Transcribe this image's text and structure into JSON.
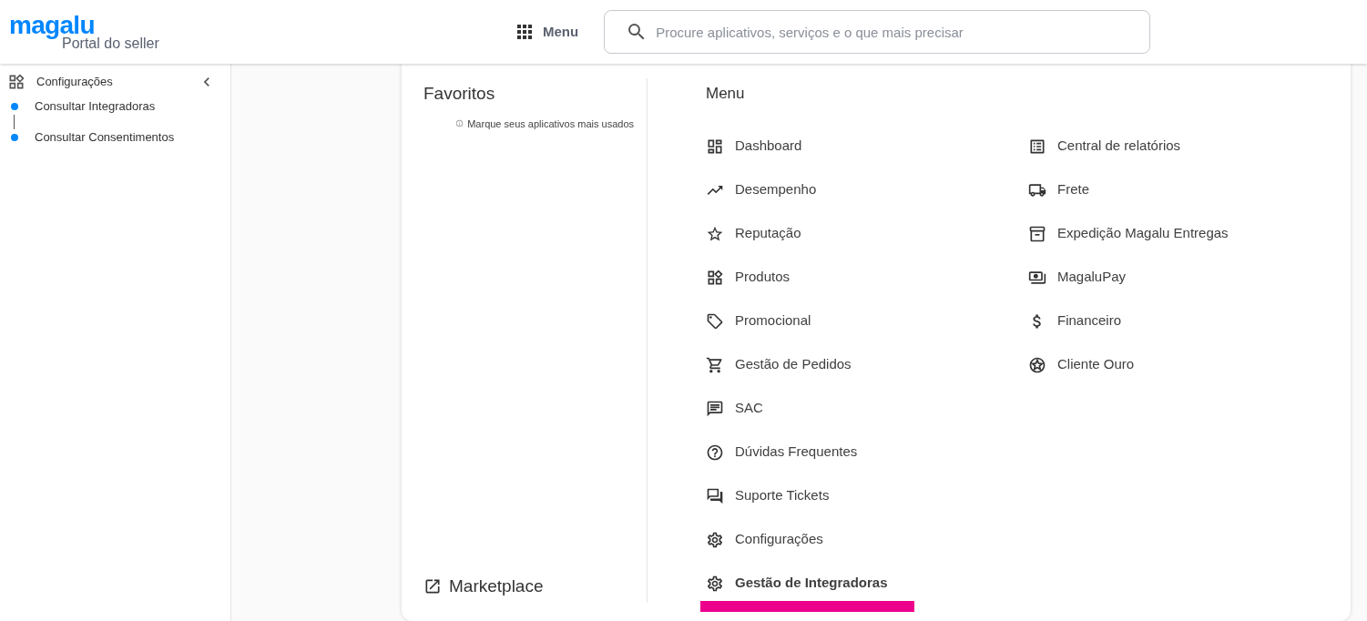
{
  "header": {
    "logo": "magalu",
    "subtitle": "Portal do seller",
    "menu_button": "Menu",
    "search": {
      "placeholder": "Procure aplicativos, serviços e o que mais precisar"
    }
  },
  "sidebar": {
    "title": "Configurações",
    "items": [
      {
        "label": "Consultar Integradoras"
      },
      {
        "label": "Consultar Consentimentos"
      }
    ]
  },
  "favorites": {
    "title": "Favoritos",
    "hint": "Marque seus aplicativos mais usados",
    "link": "Marketplace"
  },
  "menu": {
    "title": "Menu",
    "columns": [
      [
        {
          "label": "Dashboard",
          "selected": false
        },
        {
          "label": "Desempenho",
          "selected": false
        },
        {
          "label": "Reputação",
          "selected": false
        },
        {
          "label": "Produtos",
          "selected": false
        },
        {
          "label": "Promocional",
          "selected": false
        },
        {
          "label": "Gestão de Pedidos",
          "selected": false
        },
        {
          "label": "SAC",
          "selected": false
        },
        {
          "label": "Dúvidas Frequentes",
          "selected": false
        },
        {
          "label": "Suporte Tickets",
          "selected": false
        },
        {
          "label": "Configurações",
          "selected": false
        },
        {
          "label": "Gestão de Integradoras",
          "selected": true
        }
      ],
      [
        {
          "label": "Central de relatórios",
          "selected": false
        },
        {
          "label": "Frete",
          "selected": false
        },
        {
          "label": "Expedição Magalu Entregas",
          "selected": false
        },
        {
          "label": "MagaluPay",
          "selected": false
        },
        {
          "label": "Financeiro",
          "selected": false
        },
        {
          "label": "Cliente Ouro",
          "selected": false
        }
      ]
    ]
  }
}
